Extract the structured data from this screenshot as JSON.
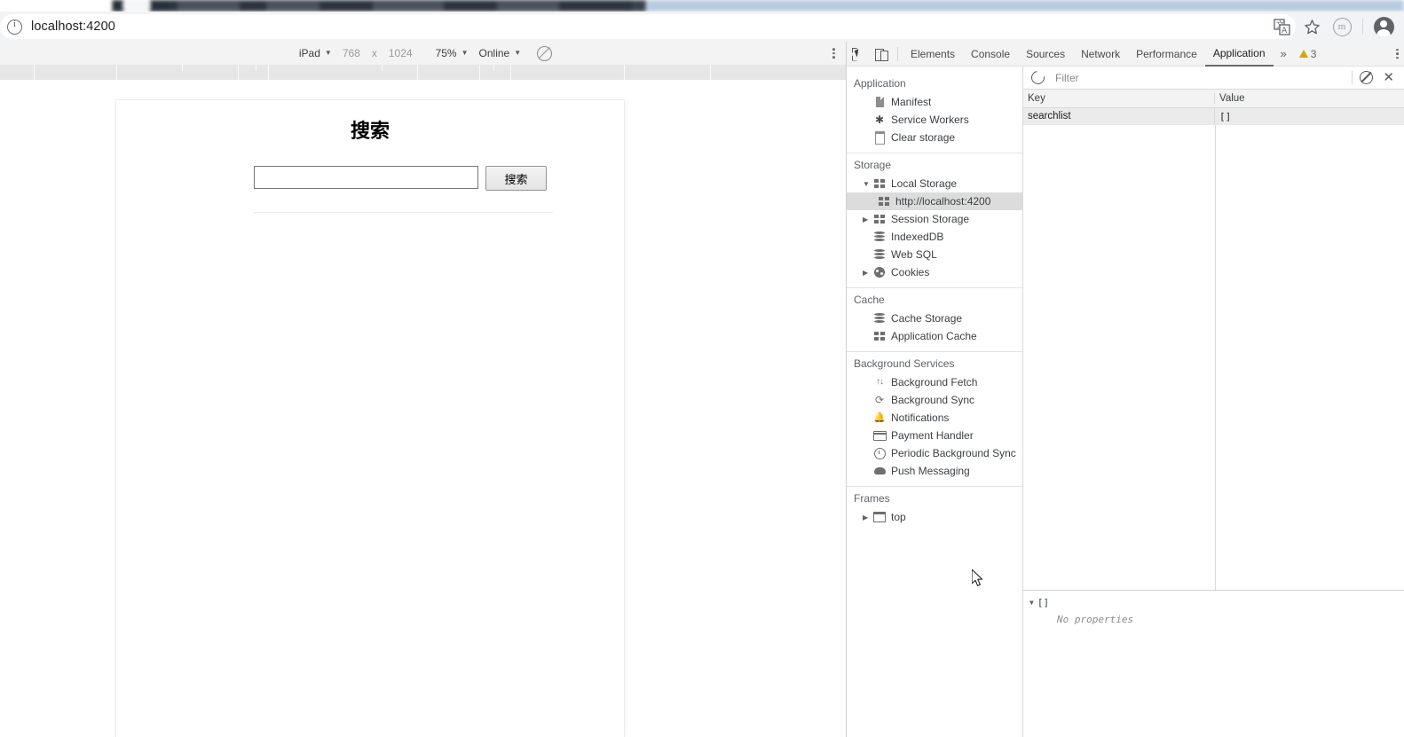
{
  "browser": {
    "url": "localhost:4200",
    "site_info_icon": "info-circle-icon",
    "actions": [
      {
        "name": "translate-icon",
        "glyph": "translate"
      },
      {
        "name": "bookmark-star-icon",
        "glyph": "star"
      },
      {
        "name": "extension-badge-icon",
        "glyph": "m"
      },
      {
        "name": "profile-avatar",
        "glyph": "person"
      }
    ]
  },
  "device_toolbar": {
    "device": "iPad",
    "width": "768",
    "times": "x",
    "height": "1024",
    "zoom": "75%",
    "throttling": "Online",
    "rotate_icon": "rotate-icon",
    "more_icon": "kebab-menu-icon"
  },
  "page": {
    "title": "搜索",
    "search_value": "",
    "search_placeholder": "",
    "button_label": "搜索"
  },
  "devtools": {
    "inspect_icon": "inspect-element-icon",
    "device_toggle_icon": "toggle-device-toolbar-icon",
    "tabs": [
      {
        "label": "Elements",
        "active": false
      },
      {
        "label": "Console",
        "active": false
      },
      {
        "label": "Sources",
        "active": false
      },
      {
        "label": "Network",
        "active": false
      },
      {
        "label": "Performance",
        "active": false
      },
      {
        "label": "Application",
        "active": true
      }
    ],
    "more_tabs": "»",
    "warning_count": "3",
    "main_menu_icon": "kebab-menu-icon",
    "sidebar": {
      "sections": [
        {
          "title": "Application",
          "items": [
            {
              "label": "Manifest",
              "icon": "document-icon",
              "twisty": "",
              "selected": false
            },
            {
              "label": "Service Workers",
              "icon": "gear-icon",
              "twisty": "",
              "selected": false
            },
            {
              "label": "Clear storage",
              "icon": "trash-icon",
              "twisty": "",
              "selected": false
            }
          ]
        },
        {
          "title": "Storage",
          "items": [
            {
              "label": "Local Storage",
              "icon": "grid-icon",
              "twisty": "▼",
              "selected": false
            },
            {
              "label": "http://localhost:4200",
              "icon": "grid-icon",
              "twisty": "",
              "selected": true,
              "indent": 2
            },
            {
              "label": "Session Storage",
              "icon": "grid-icon",
              "twisty": "▶",
              "selected": false
            },
            {
              "label": "IndexedDB",
              "icon": "database-icon",
              "twisty": "",
              "selected": false
            },
            {
              "label": "Web SQL",
              "icon": "database-icon",
              "twisty": "",
              "selected": false
            },
            {
              "label": "Cookies",
              "icon": "cookie-icon",
              "twisty": "▶",
              "selected": false
            }
          ]
        },
        {
          "title": "Cache",
          "items": [
            {
              "label": "Cache Storage",
              "icon": "database-icon",
              "twisty": "",
              "selected": false
            },
            {
              "label": "Application Cache",
              "icon": "grid-icon",
              "twisty": "",
              "selected": false
            }
          ]
        },
        {
          "title": "Background Services",
          "items": [
            {
              "label": "Background Fetch",
              "icon": "up-down-arrows-icon",
              "twisty": "",
              "selected": false
            },
            {
              "label": "Background Sync",
              "icon": "sync-icon",
              "twisty": "",
              "selected": false
            },
            {
              "label": "Notifications",
              "icon": "bell-icon",
              "twisty": "",
              "selected": false
            },
            {
              "label": "Payment Handler",
              "icon": "credit-card-icon",
              "twisty": "",
              "selected": false
            },
            {
              "label": "Periodic Background Sync",
              "icon": "clock-icon",
              "twisty": "",
              "selected": false
            },
            {
              "label": "Push Messaging",
              "icon": "cloud-icon",
              "twisty": "",
              "selected": false
            }
          ]
        },
        {
          "title": "Frames",
          "items": [
            {
              "label": "top",
              "icon": "frame-icon",
              "twisty": "▶",
              "selected": false
            }
          ]
        }
      ]
    },
    "storage_panel": {
      "refresh_icon": "refresh-icon",
      "filter_placeholder": "Filter",
      "filter_value": "",
      "clear_filter_icon": "block-icon",
      "delete_icon": "close-x-icon",
      "columns": [
        "Key",
        "Value"
      ],
      "rows": [
        {
          "key": "searchlist",
          "value": "[]"
        }
      ],
      "preview": {
        "twisty": "▼",
        "value": "[]",
        "empty_text": "No properties"
      }
    }
  }
}
